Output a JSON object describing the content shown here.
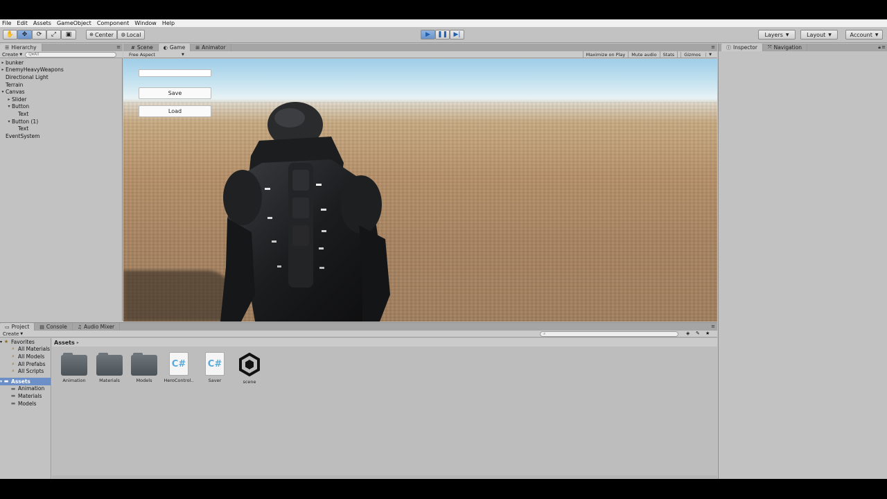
{
  "menu": [
    "File",
    "Edit",
    "Assets",
    "GameObject",
    "Component",
    "Window",
    "Help"
  ],
  "toolbar": {
    "pivot_label": "Center",
    "space_label": "Local",
    "layers_label": "Layers",
    "layout_label": "Layout",
    "account_label": "Account"
  },
  "hierarchy": {
    "tab": "Hierarchy",
    "create_label": "Create",
    "search_placeholder": "Q▾All",
    "items": [
      {
        "label": "bunker",
        "depth": 0,
        "arrow": "▸"
      },
      {
        "label": "EnemyHeavyWeapons",
        "depth": 0,
        "arrow": "▸"
      },
      {
        "label": "Directional Light",
        "depth": 0,
        "arrow": ""
      },
      {
        "label": "Terrain",
        "depth": 0,
        "arrow": ""
      },
      {
        "label": "Canvas",
        "depth": 0,
        "arrow": "▾"
      },
      {
        "label": "Slider",
        "depth": 1,
        "arrow": "▸"
      },
      {
        "label": "Button",
        "depth": 1,
        "arrow": "▾"
      },
      {
        "label": "Text",
        "depth": 2,
        "arrow": ""
      },
      {
        "label": "Button (1)",
        "depth": 1,
        "arrow": "▾"
      },
      {
        "label": "Text",
        "depth": 2,
        "arrow": ""
      },
      {
        "label": "EventSystem",
        "depth": 0,
        "arrow": ""
      }
    ]
  },
  "center_tabs": {
    "scene": "Scene",
    "game": "Game",
    "animator": "Animator"
  },
  "game_toolbar": {
    "aspect": "Free Aspect",
    "maximize": "Maximize on Play",
    "mute": "Mute audio",
    "stats": "Stats",
    "gizmos": "Gizmos"
  },
  "game_ui": {
    "save_label": "Save",
    "load_label": "Load",
    "input_value": ""
  },
  "inspector_tabs": {
    "inspector": "Inspector",
    "navigation": "Navigation"
  },
  "bottom_tabs": {
    "project": "Project",
    "console": "Console",
    "audio_mixer": "Audio Mixer"
  },
  "project": {
    "create_label": "Create",
    "breadcrumb": "Assets",
    "favorites_label": "Favorites",
    "favorites": [
      "All Materials",
      "All Models",
      "All Prefabs",
      "All Scripts"
    ],
    "assets_label": "Assets",
    "asset_folders": [
      "Animation",
      "Materials",
      "Models"
    ],
    "assets": [
      {
        "name": "Animation",
        "kind": "folder"
      },
      {
        "name": "Materials",
        "kind": "folder"
      },
      {
        "name": "Models",
        "kind": "folder"
      },
      {
        "name": "HeroControl..",
        "kind": "script"
      },
      {
        "name": "Saver",
        "kind": "script"
      },
      {
        "name": "scene",
        "kind": "unity-scene"
      }
    ]
  },
  "colors": {
    "editor_bg": "#c2c2c2",
    "selection": "#6b8fc6",
    "play_active": "#7aa6dc"
  }
}
